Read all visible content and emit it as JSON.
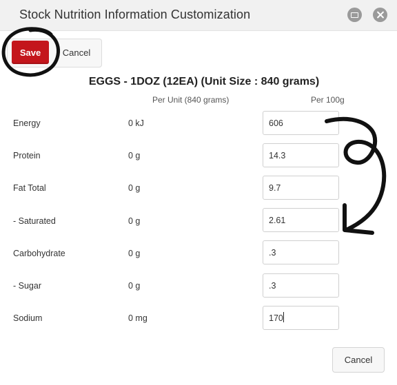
{
  "window": {
    "title": "Stock Nutrition Information Customization",
    "controls": {
      "restore_icon": "restore-window-icon",
      "close_icon": "close-icon"
    }
  },
  "toolbar": {
    "save_label": "Save",
    "cancel_label": "Cancel"
  },
  "product": {
    "heading": "EGGS - 1DOZ (12EA) (Unit Size : 840 grams)"
  },
  "columns": {
    "per_unit": "Per Unit (840 grams)",
    "per_100g": "Per 100g"
  },
  "nutrients": [
    {
      "label": "Energy",
      "per_unit": "0 kJ",
      "per_100g": "606"
    },
    {
      "label": "Protein",
      "per_unit": "0 g",
      "per_100g": "14.3"
    },
    {
      "label": "Fat Total",
      "per_unit": "0 g",
      "per_100g": "9.7"
    },
    {
      "label": "- Saturated",
      "per_unit": "0 g",
      "per_100g": "2.61"
    },
    {
      "label": "Carbohydrate",
      "per_unit": "0 g",
      "per_100g": ".3"
    },
    {
      "label": "- Sugar",
      "per_unit": "0 g",
      "per_100g": ".3"
    },
    {
      "label": "Sodium",
      "per_unit": "0 mg",
      "per_100g": "170"
    }
  ],
  "footer": {
    "cancel_label": "Cancel"
  },
  "colors": {
    "save_button": "#c4161c",
    "titlebar": "#f1f1f1",
    "window_controls": "#9a9a9a"
  }
}
